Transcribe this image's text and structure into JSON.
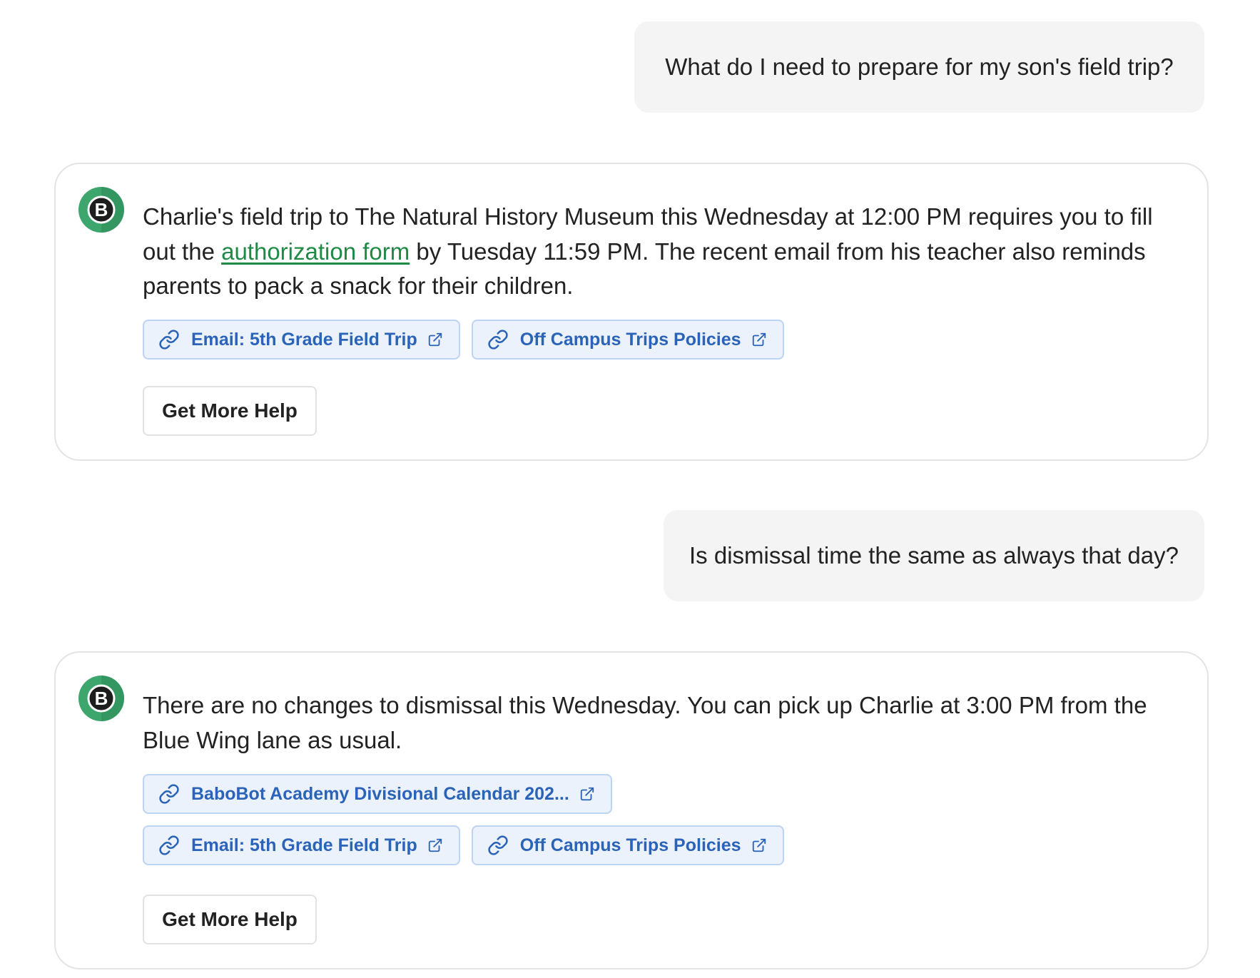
{
  "conversation": [
    {
      "role": "user",
      "text": "What do I need to prepare for my son's field trip?"
    },
    {
      "role": "assistant",
      "avatar_letter": "B",
      "text_before_link": "Charlie's field trip to The Natural History Museum this Wednesday at 12:00 PM requires you to fill out the ",
      "link_text": "authorization form",
      "text_after_link": " by Tuesday 11:59 PM. The recent email from his teacher also reminds parents to pack a snack for their children.",
      "sources": [
        {
          "label": "Email: 5th Grade Field Trip"
        },
        {
          "label": "Off Campus Trips Policies"
        }
      ],
      "help_button": "Get More Help"
    },
    {
      "role": "user",
      "text": "Is dismissal time the same as always that day?"
    },
    {
      "role": "assistant",
      "avatar_letter": "B",
      "text": "There are no changes to dismissal this Wednesday. You can pick up Charlie at 3:00 PM from the Blue Wing lane as usual.",
      "sources": [
        {
          "label": "BaboBot Academy Divisional Calendar 202..."
        },
        {
          "label": "Email: 5th Grade Field Trip"
        },
        {
          "label": "Off Campus Trips Policies"
        }
      ],
      "help_button": "Get More Help"
    }
  ],
  "icons": {
    "avatar": "bot-logo-icon",
    "chip_leading": "link-icon",
    "chip_trailing": "external-link-icon"
  },
  "colors": {
    "user_bubble_bg": "#f4f4f4",
    "chip_bg": "#ebf2fc",
    "chip_border": "#bcd3f2",
    "chip_text": "#2a63b8",
    "link_green": "#1f8a46",
    "avatar_green": "#3da66d"
  }
}
